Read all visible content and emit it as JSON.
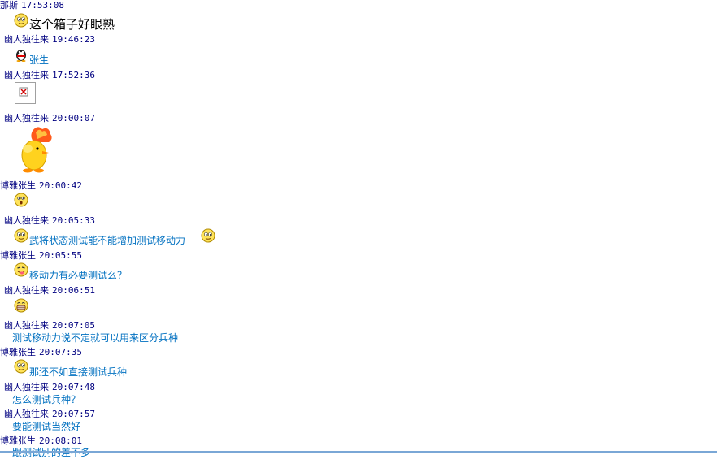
{
  "colors": {
    "sender": "#000080",
    "message": "#0070c0",
    "background": "#ffffff"
  },
  "chat": {
    "m1": {
      "sender": "那斯",
      "time": "17:53:08",
      "text": "这个箱子好眼熟",
      "icon": "smiley-face-icon"
    },
    "m2": {
      "sender": "幽人独往来",
      "time": "19:46:23",
      "text": "张生",
      "icon": "penguin-icon"
    },
    "m3": {
      "sender": "幽人独往来",
      "time": "17:52:36",
      "icon": "broken-image-icon"
    },
    "m4": {
      "sender": "幽人独往来",
      "time": "20:00:07",
      "icon": "yellow-chick-sticker"
    },
    "m5": {
      "sender": "博雅张生",
      "time": "20:00:42",
      "icon": "surprised-face-icon"
    },
    "m6": {
      "sender": "幽人独往来",
      "time": "20:05:33",
      "text": "武将状态测试能不能增加测试移动力",
      "icon": "smiley-face-icon"
    },
    "m7": {
      "sender": "博雅张生",
      "time": "20:05:55",
      "text": "移动力有必要测试么？",
      "icon": "tongue-face-icon"
    },
    "m8": {
      "sender": "幽人独往来",
      "time": "20:06:51",
      "icon": "grin-face-icon"
    },
    "m9": {
      "sender": "幽人独往来",
      "time": "20:07:05",
      "text": "测试移动力说不定就可以用来区分兵种"
    },
    "m10": {
      "sender": "博雅张生",
      "time": "20:07:35",
      "text": "那还不如直接测试兵种",
      "icon": "smiley-face-icon"
    },
    "m11": {
      "sender": "幽人独往来",
      "time": "20:07:48",
      "text": "怎么测试兵种？"
    },
    "m12": {
      "sender": "幽人独往来",
      "time": "20:07:57",
      "text": "要能测试当然好"
    },
    "m13": {
      "sender": "博雅张生",
      "time": "20:08:01",
      "text": "跟测试别的差不多"
    }
  }
}
